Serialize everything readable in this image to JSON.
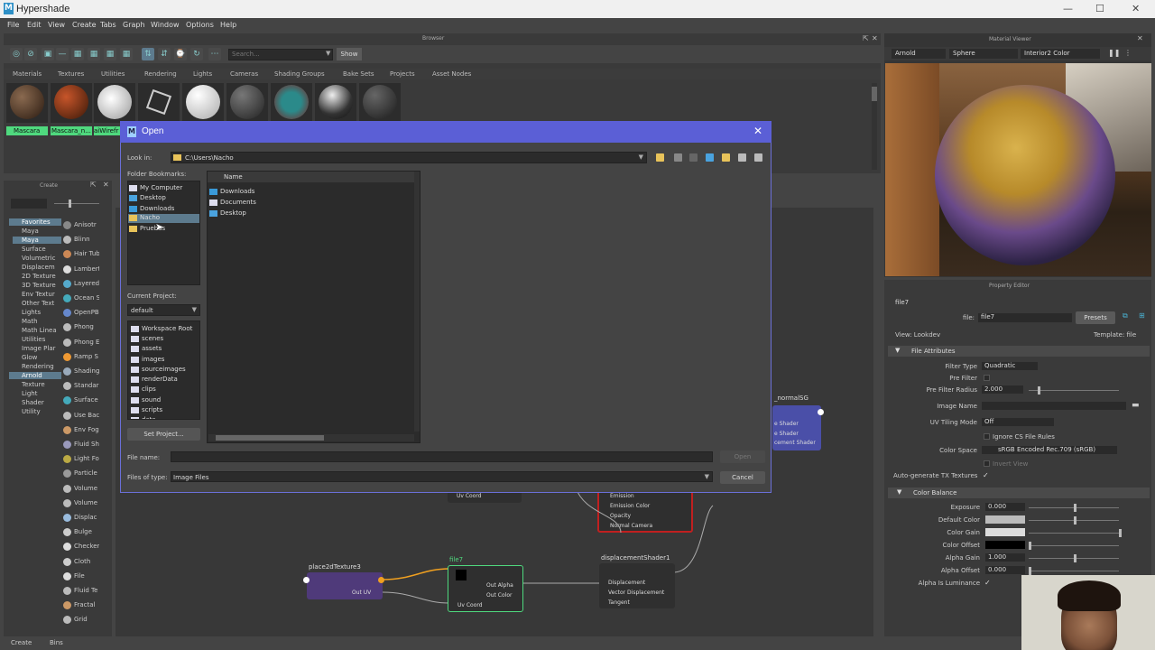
{
  "window": {
    "title": "Hypershade"
  },
  "menu": [
    "File",
    "Edit",
    "View",
    "Create",
    "Tabs",
    "Graph",
    "Window",
    "Options",
    "Help"
  ],
  "browser": {
    "title": "Browser",
    "search_placeholder": "Search...",
    "show_label": "Show",
    "tabs": [
      "Materials",
      "Textures",
      "Utilities",
      "Rendering",
      "Lights",
      "Cameras",
      "Shading Groups",
      "Bake Sets",
      "Projects",
      "Asset Nodes"
    ],
    "swatches": [
      "Mascara",
      "Mascara_n...",
      "aiWirefr"
    ]
  },
  "material_viewer": {
    "title": "Material Viewer",
    "renderer": "Arnold",
    "shape": "Sphere",
    "env": "Interior2 Color"
  },
  "property_editor": {
    "title": "Property Editor",
    "node_tab": "file7",
    "file_label": "file:",
    "file_value": "file7",
    "presets": "Presets",
    "view_label": "View: Lookdev",
    "template_label": "Template: file",
    "section_file_attrs": "File Attributes",
    "filter_type_label": "Filter Type",
    "filter_type_value": "Quadratic",
    "pre_filter_label": "Pre Filter",
    "pre_filter_radius_label": "Pre Filter Radius",
    "pre_filter_radius_value": "2.000",
    "image_name_label": "Image Name",
    "uv_tiling_label": "UV Tiling Mode",
    "uv_tiling_value": "Off",
    "ignore_cs": "Ignore CS File Rules",
    "color_space_label": "Color Space",
    "color_space_value": "sRGB Encoded Rec.709 (sRGB)",
    "invert_view": "Invert View",
    "auto_tx": "Auto-generate TX Textures",
    "section_color_balance": "Color Balance",
    "exposure_label": "Exposure",
    "exposure_value": "0.000",
    "default_color_label": "Default Color",
    "color_gain_label": "Color Gain",
    "color_offset_label": "Color Offset",
    "alpha_gain_label": "Alpha Gain",
    "alpha_gain_value": "1.000",
    "alpha_offset_label": "Alpha Offset",
    "alpha_offset_value": "0.000",
    "alpha_is_lum_label": "Alpha Is Luminance"
  },
  "create_panel": {
    "title": "Create",
    "tree": [
      "Favorites",
      "Maya",
      "Maya",
      "Surface",
      "Volumetric",
      "Displacem",
      "2D Texture",
      "3D Texture",
      "Env Textur",
      "Other Text",
      "Lights",
      "Math",
      "Math Linea",
      "Utilities",
      "Image Plar",
      "Glow",
      "Rendering",
      "Arnold",
      "Texture",
      "Light",
      "Shader",
      "Utility"
    ],
    "nodes": [
      "Anisotr",
      "Blinn",
      "Hair Tub",
      "Lambert",
      "Layered",
      "Ocean S",
      "OpenPB",
      "Phong",
      "Phong E",
      "Ramp S",
      "Shading",
      "Standar",
      "Surface",
      "Use Bac",
      "Env Fog",
      "Fluid Sh",
      "Light Fo",
      "Particle",
      "Volume",
      "Volume",
      "Displac",
      "Bulge",
      "Checker",
      "Cloth",
      "File",
      "Fluid Te",
      "Fractal",
      "Grid"
    ]
  },
  "bottom_tabs": [
    "Create",
    "Bins"
  ],
  "graph": {
    "place2d_title": "place2dTexture3",
    "place2d_port": "Out UV",
    "file_title": "file7",
    "file_ports": [
      "Out Alpha",
      "Out Color",
      "Uv Coord"
    ],
    "disp_title": "displacementShader1",
    "disp_ports": [
      "Displacement",
      "Vector Displacement",
      "Tangent"
    ],
    "uvcoord_port": "Uv Coord",
    "shader_ports": [
      "Emission",
      "Emission Color",
      "Opacity",
      "Normal Camera"
    ],
    "sg_title": "_normalSG",
    "sg_ports": [
      "e Shader",
      "e Shader",
      "cement Shader"
    ]
  },
  "dialog": {
    "title": "Open",
    "look_in_label": "Look in:",
    "look_in_value": "C:\\Users\\Nacho",
    "bookmarks_label": "Folder Bookmarks:",
    "bookmarks": [
      "My Computer",
      "Desktop",
      "Downloads",
      "Nacho",
      "Pruebas"
    ],
    "name_header": "Name",
    "files": [
      "Downloads",
      "Documents",
      "Desktop"
    ],
    "current_project_label": "Current Project:",
    "current_project_value": "default",
    "project_folders": [
      "Workspace Root",
      "scenes",
      "assets",
      "images",
      "sourceimages",
      "renderData",
      "clips",
      "sound",
      "scripts",
      "data"
    ],
    "set_project": "Set Project...",
    "file_name_label": "File name:",
    "file_name_value": "",
    "files_of_type_label": "Files of type:",
    "files_of_type_value": "Image Files",
    "open_btn": "Open",
    "cancel_btn": "Cancel"
  }
}
